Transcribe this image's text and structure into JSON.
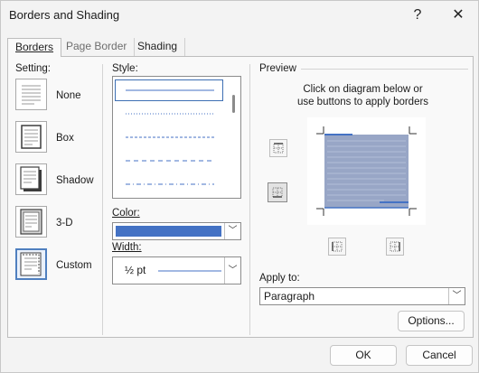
{
  "window": {
    "title": "Borders and Shading",
    "help": "?",
    "close": "✕"
  },
  "tabs": [
    {
      "label": "Borders",
      "active": true
    },
    {
      "label": "Page Border",
      "active": false
    },
    {
      "label": "Shading",
      "active": false
    }
  ],
  "setting": {
    "label": "Setting:",
    "items": [
      {
        "label": "None",
        "icon": "none-setting-icon"
      },
      {
        "label": "Box",
        "icon": "box-setting-icon"
      },
      {
        "label": "Shadow",
        "icon": "shadow-setting-icon"
      },
      {
        "label": "3-D",
        "icon": "3d-setting-icon"
      },
      {
        "label": "Custom",
        "icon": "custom-setting-icon",
        "selected": true
      }
    ]
  },
  "style": {
    "label": "Style:"
  },
  "color": {
    "label": "Color:",
    "value_hex": "#4472c4"
  },
  "width": {
    "label": "Width:",
    "value": "½ pt"
  },
  "preview": {
    "label": "Preview",
    "hint": "Click on diagram below or use buttons to apply borders",
    "hint_line1": "Click on diagram below or",
    "hint_line2": "use buttons to apply borders"
  },
  "apply_to": {
    "label": "Apply to:",
    "value": "Paragraph"
  },
  "buttons": {
    "options": "Options...",
    "ok": "OK",
    "cancel": "Cancel"
  },
  "colors": {
    "accent": "#4472c4",
    "preview_fill": "#98a6c6",
    "selection": "#4f7fbf"
  }
}
